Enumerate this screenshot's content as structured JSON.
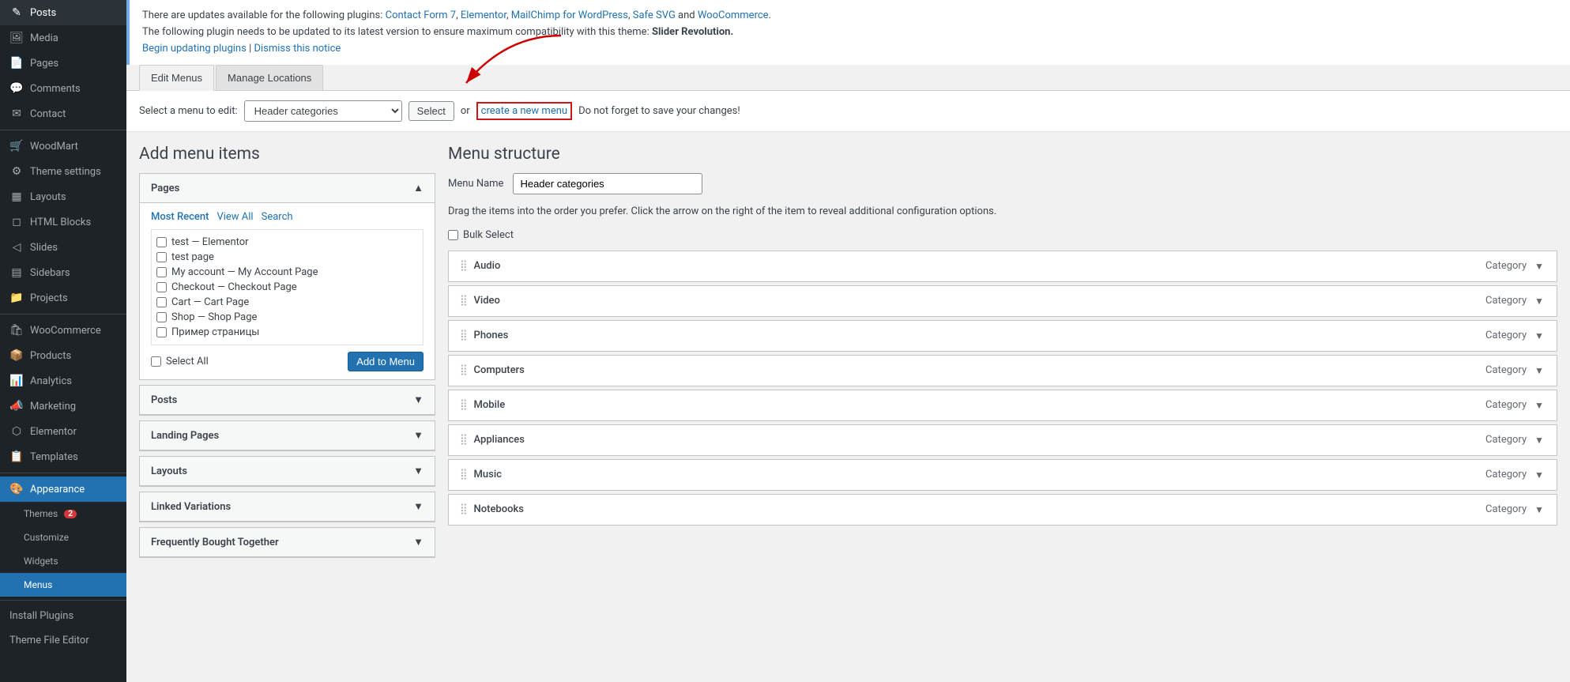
{
  "sidebar": {
    "items": [
      {
        "id": "posts",
        "label": "Posts",
        "icon": "✎",
        "active": false
      },
      {
        "id": "media",
        "label": "Media",
        "icon": "🖼",
        "active": false
      },
      {
        "id": "pages",
        "label": "Pages",
        "icon": "📄",
        "active": false
      },
      {
        "id": "comments",
        "label": "Comments",
        "icon": "💬",
        "active": false
      },
      {
        "id": "contact",
        "label": "Contact",
        "icon": "✉",
        "active": false
      },
      {
        "id": "woodmart",
        "label": "WoodMart",
        "icon": "🛒",
        "active": false
      },
      {
        "id": "theme-settings",
        "label": "Theme settings",
        "icon": "⚙",
        "active": false
      },
      {
        "id": "layouts",
        "label": "Layouts",
        "icon": "▦",
        "active": false
      },
      {
        "id": "html-blocks",
        "label": "HTML Blocks",
        "icon": "◻",
        "active": false
      },
      {
        "id": "slides",
        "label": "Slides",
        "icon": "◁",
        "active": false
      },
      {
        "id": "sidebars",
        "label": "Sidebars",
        "icon": "▤",
        "active": false
      },
      {
        "id": "projects",
        "label": "Projects",
        "icon": "📁",
        "active": false
      },
      {
        "id": "woocommerce",
        "label": "WooCommerce",
        "icon": "🛍",
        "active": false
      },
      {
        "id": "products",
        "label": "Products",
        "icon": "📦",
        "active": false
      },
      {
        "id": "analytics",
        "label": "Analytics",
        "icon": "📊",
        "active": false
      },
      {
        "id": "marketing",
        "label": "Marketing",
        "icon": "📣",
        "active": false
      },
      {
        "id": "elementor",
        "label": "Elementor",
        "icon": "⬡",
        "active": false
      },
      {
        "id": "templates",
        "label": "Templates",
        "icon": "📋",
        "active": false
      },
      {
        "id": "appearance",
        "label": "Appearance",
        "icon": "🎨",
        "active": true
      }
    ],
    "appearance_sub": [
      {
        "id": "themes",
        "label": "Themes",
        "badge": "2"
      },
      {
        "id": "customize",
        "label": "Customize"
      },
      {
        "id": "widgets",
        "label": "Widgets"
      },
      {
        "id": "menus",
        "label": "Menus",
        "active": true
      }
    ],
    "bottom": [
      {
        "id": "install-plugins",
        "label": "Install Plugins"
      },
      {
        "id": "theme-file-editor",
        "label": "Theme File Editor"
      }
    ]
  },
  "notice": {
    "line1_text": "There are updates available for the following plugins: ",
    "plugins": [
      {
        "label": "Contact Form 7",
        "href": "#"
      },
      {
        "label": "Elementor",
        "href": "#"
      },
      {
        "label": "MailChimp for WordPress",
        "href": "#"
      },
      {
        "label": "Safe SVG",
        "href": "#"
      },
      {
        "label": "WooCommerce",
        "href": "#"
      }
    ],
    "line2_text": "The following plugin needs to be updated to its latest version to ensure maximum compatibility with this theme: ",
    "plugin_name": "Slider Revolution.",
    "begin_link": "Begin updating plugins",
    "dismiss_link": "Dismiss this notice"
  },
  "tabs": [
    {
      "id": "edit-menus",
      "label": "Edit Menus",
      "active": true
    },
    {
      "id": "manage-locations",
      "label": "Manage Locations",
      "active": false
    }
  ],
  "select_menu_row": {
    "label": "Select a menu to edit:",
    "selected_value": "Header categories",
    "select_btn": "Select",
    "or_text": "or",
    "create_link": "create a new menu",
    "reminder": "Do not forget to save your changes!"
  },
  "left_panel": {
    "title": "Add menu items",
    "sections": [
      {
        "id": "pages",
        "label": "Pages",
        "open": true,
        "sub_tabs": [
          {
            "id": "most-recent",
            "label": "Most Recent",
            "active": true
          },
          {
            "id": "view-all",
            "label": "View All",
            "active": false
          },
          {
            "id": "search",
            "label": "Search",
            "active": false
          }
        ],
        "items": [
          {
            "id": "test-elementor",
            "label": "test — Elementor"
          },
          {
            "id": "test-page",
            "label": "test page"
          },
          {
            "id": "my-account",
            "label": "My account — My Account Page"
          },
          {
            "id": "checkout",
            "label": "Checkout — Checkout Page"
          },
          {
            "id": "cart",
            "label": "Cart — Cart Page"
          },
          {
            "id": "shop",
            "label": "Shop — Shop Page"
          },
          {
            "id": "primer-stranicy",
            "label": "Пример страницы"
          }
        ],
        "select_all_label": "Select All",
        "add_btn": "Add to Menu"
      },
      {
        "id": "posts",
        "label": "Posts",
        "open": false
      },
      {
        "id": "landing-pages",
        "label": "Landing Pages",
        "open": false
      },
      {
        "id": "layouts",
        "label": "Layouts",
        "open": false
      },
      {
        "id": "linked-variations",
        "label": "Linked Variations",
        "open": false
      },
      {
        "id": "frequently-bought",
        "label": "Frequently Bought Together",
        "open": false
      }
    ]
  },
  "right_panel": {
    "title": "Menu structure",
    "menu_name_label": "Menu Name",
    "menu_name_value": "Header categories",
    "description": "Drag the items into the order you prefer. Click the arrow on the right of the item to reveal additional configuration options.",
    "bulk_select_label": "Bulk Select",
    "items": [
      {
        "id": "audio",
        "label": "Audio",
        "type": "Category"
      },
      {
        "id": "video",
        "label": "Video",
        "type": "Category"
      },
      {
        "id": "phones",
        "label": "Phones",
        "type": "Category"
      },
      {
        "id": "computers",
        "label": "Computers",
        "type": "Category"
      },
      {
        "id": "mobile",
        "label": "Mobile",
        "type": "Category"
      },
      {
        "id": "appliances",
        "label": "Appliances",
        "type": "Category"
      },
      {
        "id": "music",
        "label": "Music",
        "type": "Category"
      },
      {
        "id": "notebooks",
        "label": "Notebooks",
        "type": "Category"
      }
    ]
  },
  "arrow": {
    "pointing_to": "create a new menu link"
  }
}
